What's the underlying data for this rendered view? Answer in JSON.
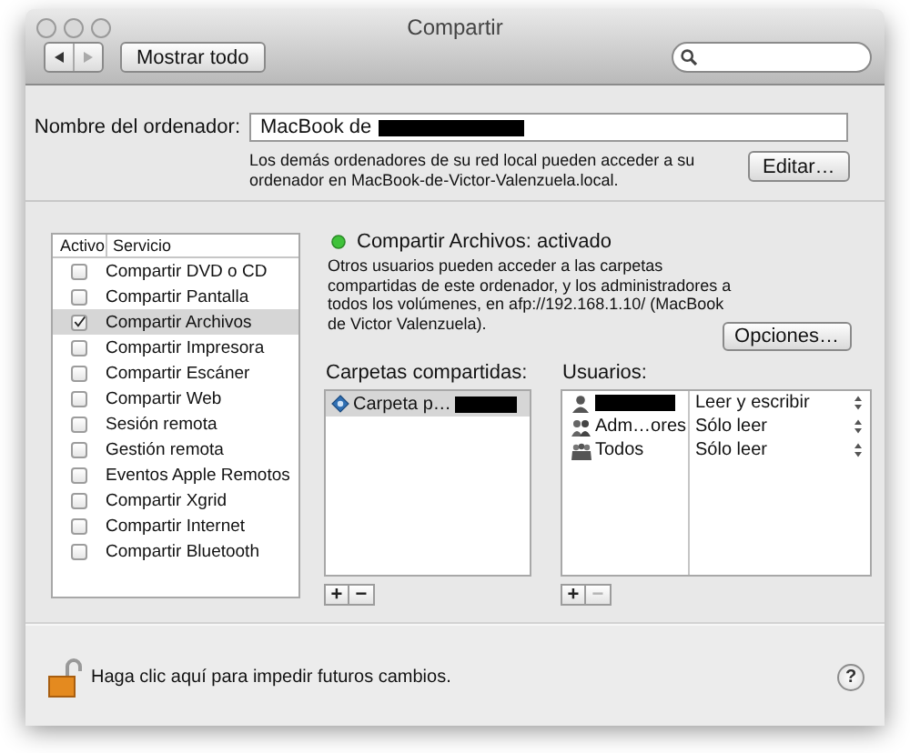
{
  "window": {
    "title": "Compartir"
  },
  "toolbar": {
    "show_all": "Mostrar todo"
  },
  "computer_name": {
    "label": "Nombre del ordenador:",
    "value": "MacBook de",
    "redacted": true,
    "note": "Los demás ordenadores de su red local pueden acceder a su ordenador en MacBook-de-Victor-Valenzuela.local.",
    "edit_button": "Editar…"
  },
  "services": {
    "columns": [
      "Activo",
      "Servicio"
    ],
    "items": [
      {
        "name": "Compartir DVD o CD",
        "checked": false,
        "selected": false
      },
      {
        "name": "Compartir Pantalla",
        "checked": false,
        "selected": false
      },
      {
        "name": "Compartir Archivos",
        "checked": true,
        "selected": true
      },
      {
        "name": "Compartir Impresora",
        "checked": false,
        "selected": false
      },
      {
        "name": "Compartir Escáner",
        "checked": false,
        "selected": false
      },
      {
        "name": "Compartir Web",
        "checked": false,
        "selected": false
      },
      {
        "name": "Sesión remota",
        "checked": false,
        "selected": false
      },
      {
        "name": "Gestión remota",
        "checked": false,
        "selected": false
      },
      {
        "name": "Eventos Apple Remotos",
        "checked": false,
        "selected": false
      },
      {
        "name": "Compartir Xgrid",
        "checked": false,
        "selected": false
      },
      {
        "name": "Compartir Internet",
        "checked": false,
        "selected": false
      },
      {
        "name": "Compartir Bluetooth",
        "checked": false,
        "selected": false
      }
    ]
  },
  "status": {
    "label": "Compartir Archivos: activado",
    "on": true,
    "description": "Otros usuarios pueden acceder a las carpetas compartidas de este ordenador, y los administradores a todos los volúmenes, en afp://192.168.1.10/ (MacBook de Victor Valenzuela).",
    "options_button": "Opciones…"
  },
  "shared_folders": {
    "label": "Carpetas compartidas:",
    "items": [
      {
        "name": "Carpeta p…",
        "redacted": true,
        "selected": true
      }
    ],
    "buttons": [
      {
        "label": "+",
        "disabled": false
      },
      {
        "label": "−",
        "disabled": false
      }
    ]
  },
  "users": {
    "label": "Usuarios:",
    "items": [
      {
        "kind": "user",
        "redacted": true,
        "permission": "Leer y escribir"
      },
      {
        "kind": "group",
        "name": "Adm…ores",
        "permission": "Sólo leer"
      },
      {
        "kind": "everyone",
        "name": "Todos",
        "permission": "Sólo leer"
      }
    ],
    "buttons": [
      {
        "label": "+",
        "disabled": false
      },
      {
        "label": "−",
        "disabled": true
      }
    ]
  },
  "footer": {
    "lock_text": "Haga clic aquí para impedir futuros cambios.",
    "locked": false,
    "help_button": "?"
  }
}
